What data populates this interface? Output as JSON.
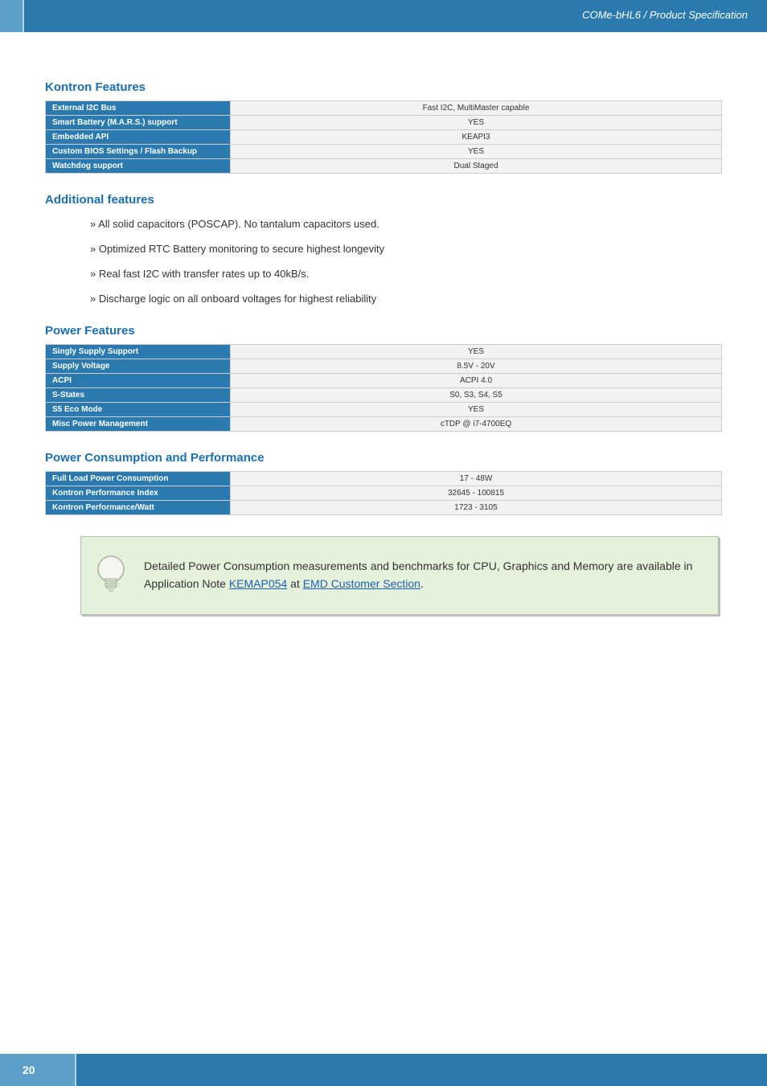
{
  "header": {
    "breadcrumb": "COMe-bHL6 / Product Specification"
  },
  "sections": {
    "kontron_features": {
      "title": "Kontron Features",
      "rows": [
        {
          "label": "External I2C Bus",
          "value": "Fast I2C, MultiMaster capable"
        },
        {
          "label": "Smart Battery (M.A.R.S.) support",
          "value": "YES"
        },
        {
          "label": "Embedded API",
          "value": "KEAPI3"
        },
        {
          "label": "Custom BIOS Settings / Flash Backup",
          "value": "YES"
        },
        {
          "label": "Watchdog support",
          "value": "Dual Staged"
        }
      ]
    },
    "additional_features": {
      "title": "Additional features",
      "items": [
        "All solid capacitors (POSCAP). No tantalum capacitors used.",
        "Optimized RTC Battery monitoring to secure highest longevity",
        "Real fast I2C with transfer rates up to 40kB/s.",
        "Discharge logic on all onboard voltages for highest reliability"
      ]
    },
    "power_features": {
      "title": "Power Features",
      "rows": [
        {
          "label": "Singly Supply Support",
          "value": "YES"
        },
        {
          "label": "Supply Voltage",
          "value": "8.5V - 20V"
        },
        {
          "label": "ACPI",
          "value": "ACPI 4.0"
        },
        {
          "label": "S-States",
          "value": "S0, S3, S4, S5"
        },
        {
          "label": "S5 Eco Mode",
          "value": "YES"
        },
        {
          "label": "Misc Power Management",
          "value": "cTDP @ i7-4700EQ"
        }
      ]
    },
    "power_consumption": {
      "title": "Power Consumption and Performance",
      "rows": [
        {
          "label": "Full Load Power Consumption",
          "value": "17 - 48W"
        },
        {
          "label": "Kontron Performance Index",
          "value": "32645 - 100815"
        },
        {
          "label": "Kontron Performance/Watt",
          "value": "1723 - 3105"
        }
      ]
    }
  },
  "note": {
    "text_before": "Detailed Power Consumption measurements and benchmarks for CPU, Graphics and Memory are available in Application Note ",
    "link1": "KEMAP054",
    "mid": " at ",
    "link2": "EMD Customer Section",
    "text_after": "."
  },
  "footer": {
    "page": "20"
  }
}
